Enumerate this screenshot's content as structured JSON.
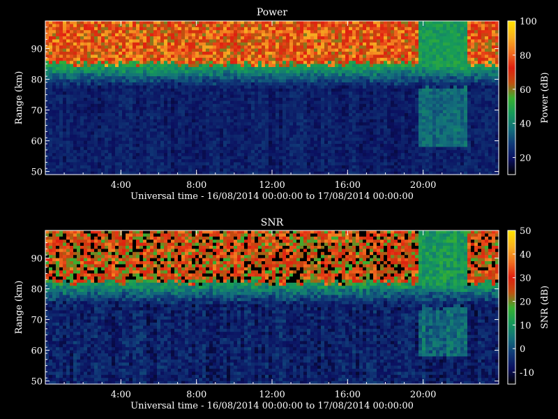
{
  "chart_data": [
    {
      "type": "heatmap",
      "title": "Power",
      "xlabel": "Universal time - 16/08/2014 00:00:00 to 17/08/2014 00:00:00",
      "ylabel": "Range (km)",
      "x_ticks": [
        "4:00",
        "8:00",
        "12:00",
        "16:00",
        "20:00"
      ],
      "x_tick_hours": [
        4,
        8,
        12,
        16,
        20
      ],
      "xlim_hours": [
        0,
        24
      ],
      "y_ticks": [
        50,
        60,
        70,
        80,
        90
      ],
      "ylim": [
        49,
        99
      ],
      "colorbar": {
        "label": "Power (dB)",
        "ticks": [
          20,
          40,
          60,
          80,
          100
        ],
        "range": [
          10,
          100
        ]
      },
      "features": {
        "strong_echo_above_km": 85,
        "strong_echo_value_db": 75,
        "background_value_db": 20,
        "weak_echo_interval_hours": [
          19.8,
          22.3
        ]
      }
    },
    {
      "type": "heatmap",
      "title": "SNR",
      "xlabel": "Universal time - 16/08/2014 00:00:00 to 17/08/2014 00:00:00",
      "ylabel": "Range (km)",
      "x_ticks": [
        "4:00",
        "8:00",
        "12:00",
        "16:00",
        "20:00"
      ],
      "x_tick_hours": [
        4,
        8,
        12,
        16,
        20
      ],
      "xlim_hours": [
        0,
        24
      ],
      "y_ticks": [
        50,
        60,
        70,
        80,
        90
      ],
      "ylim": [
        49,
        99
      ],
      "colorbar": {
        "label": "SNR (dB)",
        "ticks": [
          -10,
          0,
          10,
          20,
          30,
          40,
          50
        ],
        "range": [
          -15,
          50
        ]
      },
      "features": {
        "strong_echo_above_km": 82,
        "strong_echo_value_db": 28,
        "background_value_db": -8,
        "weak_echo_interval_hours": [
          19.8,
          22.3
        ]
      }
    }
  ],
  "colormap": [
    "#000000",
    "#0b1060",
    "#103a78",
    "#13707a",
    "#169a5a",
    "#38b030",
    "#c05010",
    "#e02010",
    "#f07020",
    "#f8b020",
    "#ffe000"
  ]
}
